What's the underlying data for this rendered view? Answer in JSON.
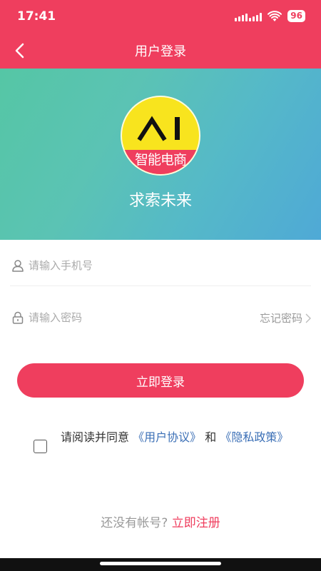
{
  "status_bar": {
    "time": "17:41",
    "battery": "96",
    "icons": [
      "signal-icon",
      "wifi-icon",
      "battery-icon"
    ]
  },
  "nav": {
    "title": "用户登录",
    "back_icon": "chevron-left-icon"
  },
  "hero": {
    "logo_text": "智能电商",
    "logo_mark": "AI",
    "slogan": "求索未来"
  },
  "form": {
    "phone_placeholder": "请输入手机号",
    "password_placeholder": "请输入密码",
    "forgot_label": "忘记密码",
    "login_label": "立即登录"
  },
  "agreement": {
    "prefix": "请阅读并同意",
    "user_agreement": "《用户协议》",
    "and": "和",
    "privacy_policy": "《隐私政策》"
  },
  "register": {
    "question": "还没有帐号?",
    "link": "立即注册"
  },
  "colors": {
    "brand": "#ef3e5e",
    "link": "#3b6fb6",
    "logo_yellow": "#f8e41e"
  }
}
